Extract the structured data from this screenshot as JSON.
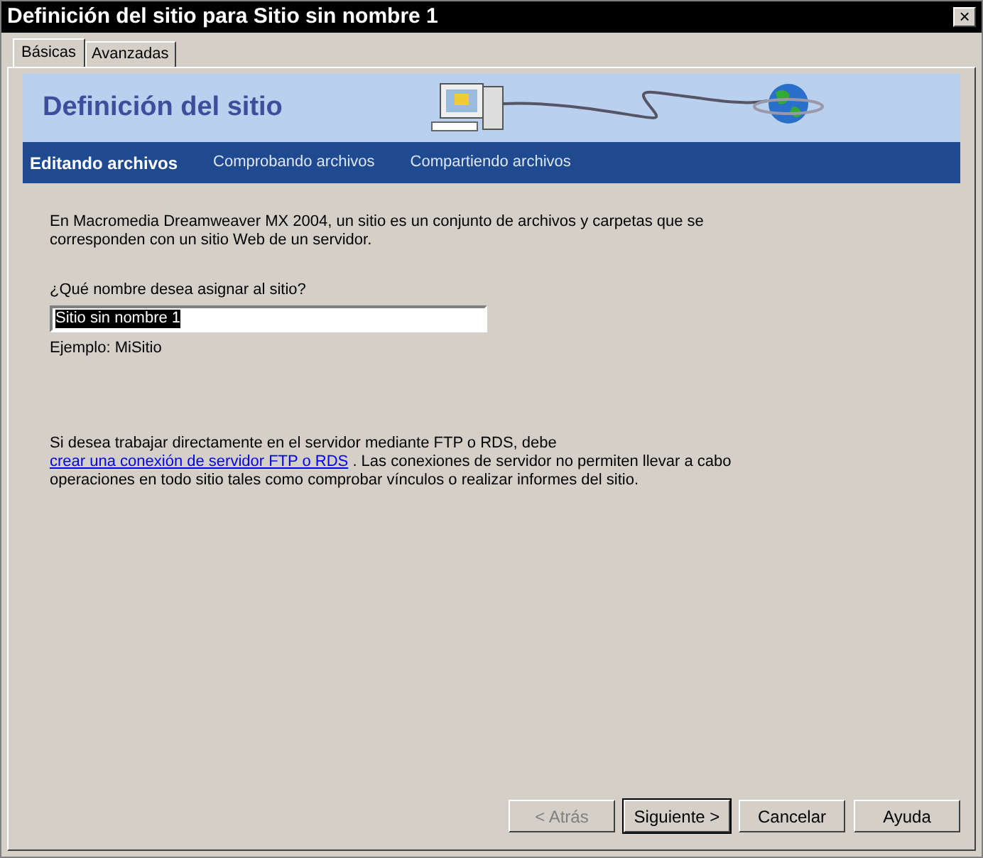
{
  "window": {
    "title": "Definición del sitio para Sitio sin nombre 1",
    "close": "×"
  },
  "tabs": [
    {
      "label": "Básicas",
      "selected": true
    },
    {
      "label": "Avanzadas",
      "selected": false
    }
  ],
  "banner": {
    "title": "Definición del sitio"
  },
  "steps": [
    {
      "label": "Editando archivos",
      "selected": true
    },
    {
      "label": "Comprobando archivos",
      "selected": false
    },
    {
      "label": "Compartiendo archivos",
      "selected": false
    }
  ],
  "intro": "En Macromedia Dreamweaver MX 2004, un sitio es un conjunto de archivos y carpetas que se corresponden con un sitio Web de un servidor.",
  "name_field": {
    "label": "¿Qué nombre desea asignar al sitio?",
    "value": "Sitio sin nombre 1",
    "example": "Ejemplo: MiSitio"
  },
  "server_note": {
    "before": "Si desea trabajar directamente en el servidor mediante FTP o RDS, debe",
    "link": "crear una conexión de servidor FTP o RDS",
    "after": ". Las conexiones de servidor no permiten llevar a cabo operaciones en todo sitio tales como comprobar vínculos o realizar informes del sitio."
  },
  "buttons": [
    {
      "label": "< Atrás",
      "disabled": true,
      "default": false
    },
    {
      "label": "Siguiente >",
      "disabled": false,
      "default": true
    },
    {
      "label": "Cancelar",
      "disabled": false,
      "default": false
    },
    {
      "label": "Ayuda",
      "disabled": false,
      "default": false
    }
  ]
}
